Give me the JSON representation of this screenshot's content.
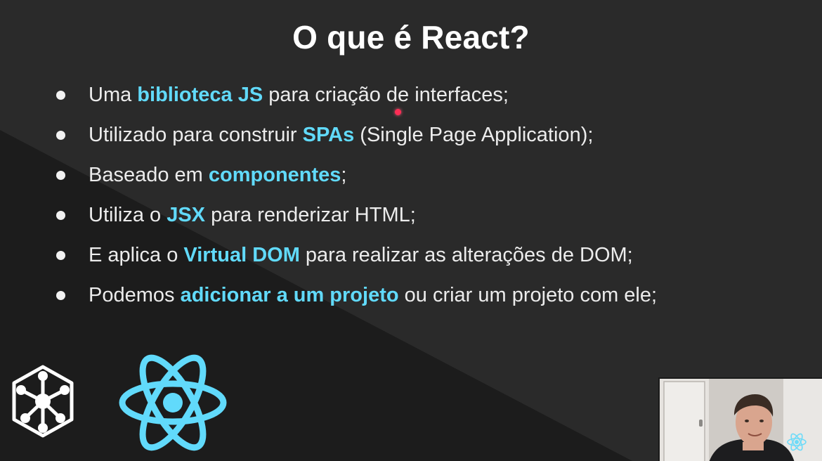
{
  "slide": {
    "title": "O que é React?",
    "bullets": [
      {
        "pre": "Uma ",
        "highlight": "biblioteca JS",
        "post": " para criação de interfaces;"
      },
      {
        "pre": "Utilizado para construir ",
        "highlight": "SPAs",
        "post": " (Single Page Application);"
      },
      {
        "pre": "Baseado em ",
        "highlight": "componentes",
        "post": ";"
      },
      {
        "pre": "Utiliza o ",
        "highlight": "JSX",
        "post": " para renderizar HTML;"
      },
      {
        "pre": "E aplica o ",
        "highlight": "Virtual DOM",
        "post": " para realizar as alterações de DOM;"
      },
      {
        "pre": "Podemos ",
        "highlight": "adicionar a um projeto",
        "post": " ou criar um projeto com ele;"
      }
    ]
  },
  "logos": {
    "left": "cube-network-icon",
    "right": "react-atom-icon",
    "watermark": "react-atom-icon"
  },
  "colors": {
    "background": "#2a2a2a",
    "background_dark": "#1c1c1c",
    "text": "#ececec",
    "accent": "#61dafb",
    "laser_pointer": "#ff2d55"
  }
}
